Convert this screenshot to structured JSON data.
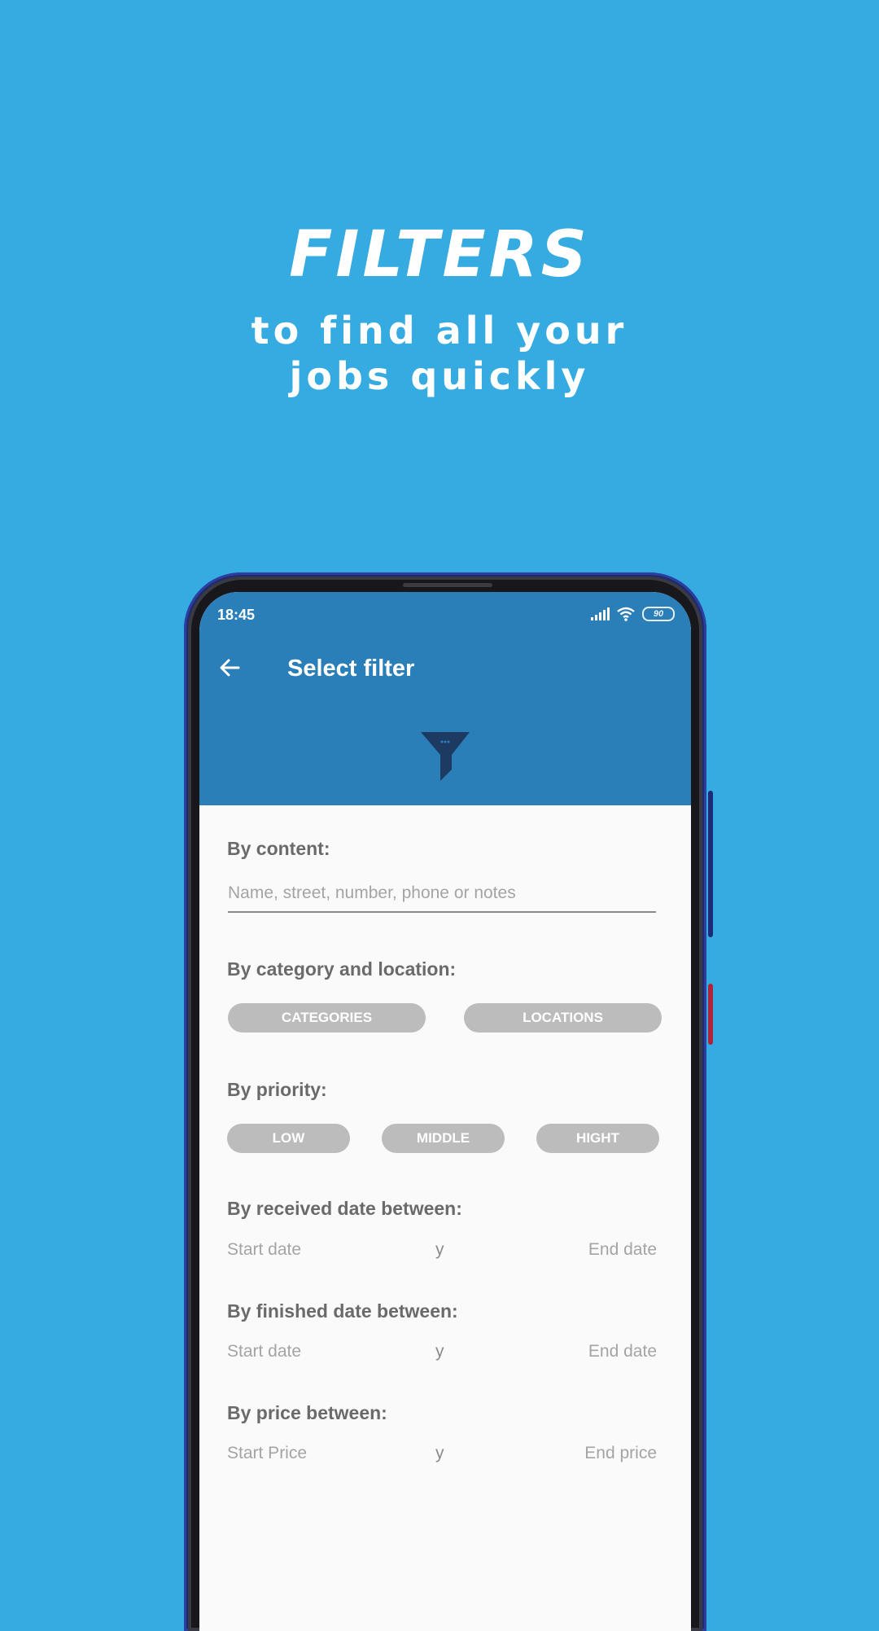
{
  "promo": {
    "headline": "FILTERS",
    "subline_1": "to find all your",
    "subline_2": "jobs quickly"
  },
  "colors": {
    "background": "#35abe1",
    "appbar": "#2b7fb9",
    "pill": "#bcbcbc",
    "label": "#6a6a6a"
  },
  "status_bar": {
    "time": "18:45",
    "battery": "90",
    "icons": [
      "signal-icon",
      "wifi-icon",
      "battery-icon"
    ]
  },
  "appbar": {
    "back_icon": "arrow-left-icon",
    "title": "Select filter",
    "header_icon": "funnel-filter-icon"
  },
  "filters": {
    "content": {
      "label": "By content:",
      "placeholder": "Name, street, number, phone or notes",
      "value": ""
    },
    "category_location": {
      "label": "By category and location:",
      "buttons": [
        "CATEGORIES",
        "LOCATIONS"
      ]
    },
    "priority": {
      "label": "By priority:",
      "buttons": [
        "LOW",
        "MIDDLE",
        "HIGHT"
      ]
    },
    "received_date": {
      "label": "By received date between:",
      "start": "Start date",
      "separator": "y",
      "end": "End date"
    },
    "finished_date": {
      "label": "By finished date between:",
      "start": "Start date",
      "separator": "y",
      "end": "End date"
    },
    "price": {
      "label": "By price between:",
      "start": "Start Price",
      "separator": "y",
      "end": "End price"
    }
  }
}
